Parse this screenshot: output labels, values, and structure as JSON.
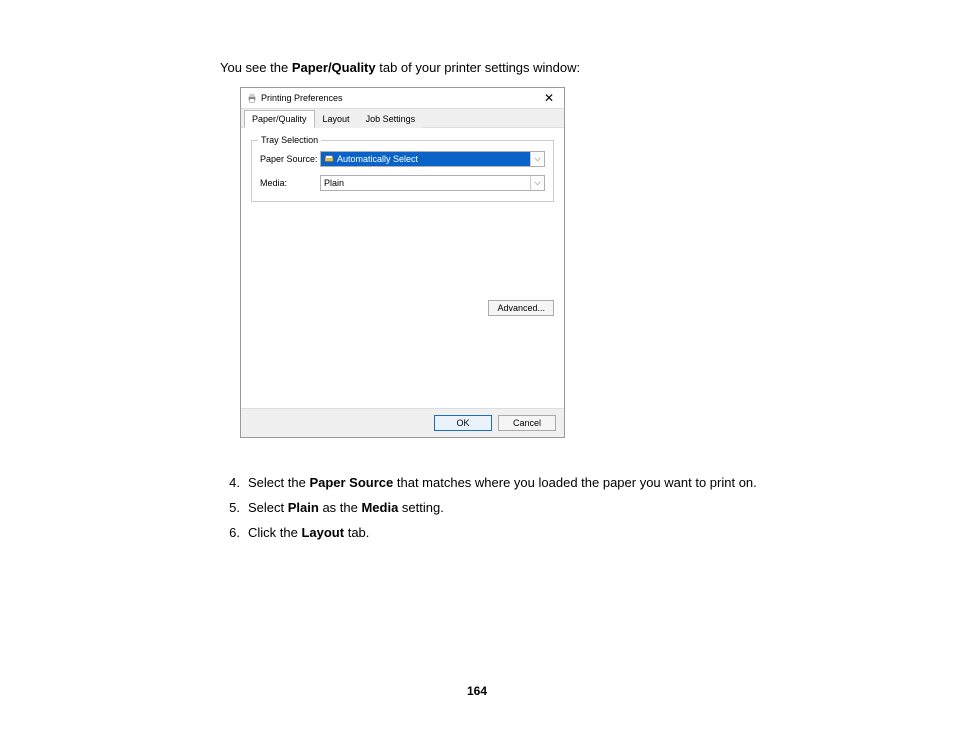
{
  "intro": {
    "pre": "You see the ",
    "bold": "Paper/Quality",
    "post": " tab of your printer settings window:"
  },
  "dialog": {
    "title": "Printing Preferences",
    "tabs": [
      "Paper/Quality",
      "Layout",
      "Job Settings"
    ],
    "legend": "Tray Selection",
    "rows": {
      "paper_source_label": "Paper Source:",
      "paper_source_value": "Automatically Select",
      "media_label": "Media:",
      "media_value": "Plain"
    },
    "advanced": "Advanced...",
    "ok": "OK",
    "cancel": "Cancel"
  },
  "steps": [
    {
      "num": "4.",
      "parts": [
        "Select the ",
        "Paper Source",
        " that matches where you loaded the paper you want to print on."
      ]
    },
    {
      "num": "5.",
      "parts": [
        "Select ",
        "Plain",
        " as the ",
        "Media",
        " setting."
      ]
    },
    {
      "num": "6.",
      "parts": [
        "Click the ",
        "Layout",
        " tab."
      ]
    }
  ],
  "page_number": "164"
}
